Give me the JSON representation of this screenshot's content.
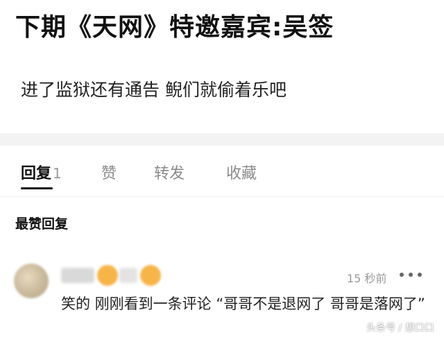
{
  "post": {
    "title": "下期《天网》特邀嘉宾:吴签",
    "body": "进了监狱还有通告 鲵们就偷着乐吧"
  },
  "tabs": [
    {
      "label": "回复",
      "count": "1",
      "active": true
    },
    {
      "label": "赞"
    },
    {
      "label": "转发"
    },
    {
      "label": "收藏"
    }
  ],
  "section": {
    "heading": "最赞回复"
  },
  "comment": {
    "timestamp": "15 秒前",
    "text": "笑的 刚刚看到一条评论 “哥哥不是退网了 哥哥是落网了”",
    "more_icon": "more-horizontal-icon"
  },
  "watermark": "头条号 / 想口口",
  "colors": {
    "background": "#ffffff",
    "divider": "#f3f3f3",
    "active_tab": "#111111",
    "inactive_tab": "#8a8a8a",
    "timestamp": "#999999",
    "badge": "#f7b449"
  }
}
